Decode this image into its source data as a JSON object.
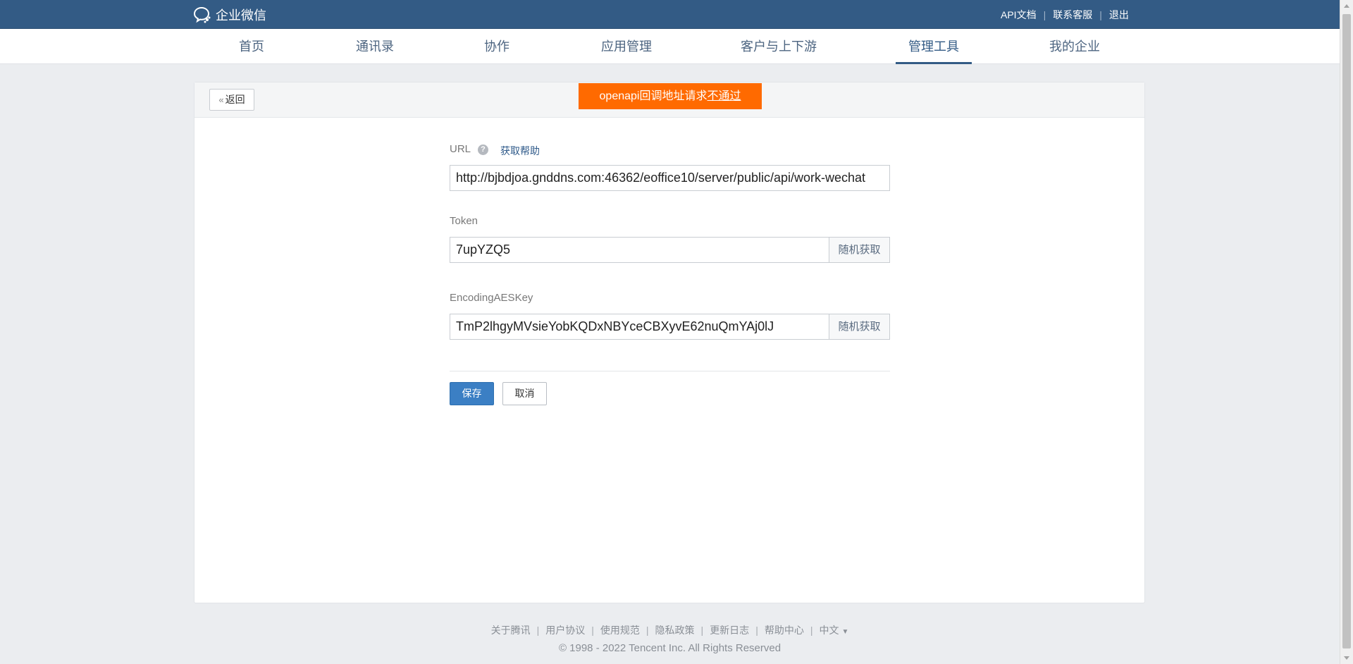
{
  "header": {
    "logo_text": "企业微信",
    "links": [
      "API文档",
      "联系客服",
      "退出"
    ]
  },
  "nav": {
    "items": [
      "首页",
      "通讯录",
      "协作",
      "应用管理",
      "客户与上下游",
      "管理工具",
      "我的企业"
    ],
    "active": "管理工具"
  },
  "card": {
    "back_label": "返回",
    "alert_prefix": "openapi回调地址请求",
    "alert_suffix": "不通过"
  },
  "form": {
    "url_label": "URL",
    "help_link": "获取帮助",
    "url_value": "http://bjbdjoa.gnddns.com:46362/eoffice10/server/public/api/work-wechat",
    "token_label": "Token",
    "token_value": "7upYZQ5",
    "aes_label": "EncodingAESKey",
    "aes_value": "TmP2lhgyMVsieYobKQDxNBYceCBXyvE62nuQmYAj0lJ",
    "random_label": "随机获取",
    "save_label": "保存",
    "cancel_label": "取消"
  },
  "footer": {
    "links": [
      "关于腾讯",
      "用户协议",
      "使用规范",
      "隐私政策",
      "更新日志",
      "帮助中心"
    ],
    "language": "中文",
    "copyright": "© 1998 - 2022 Tencent Inc. All Rights Reserved"
  },
  "colors": {
    "topbar": "#335b85",
    "accent": "#3b7fc4",
    "alert": "#ff6a00"
  }
}
